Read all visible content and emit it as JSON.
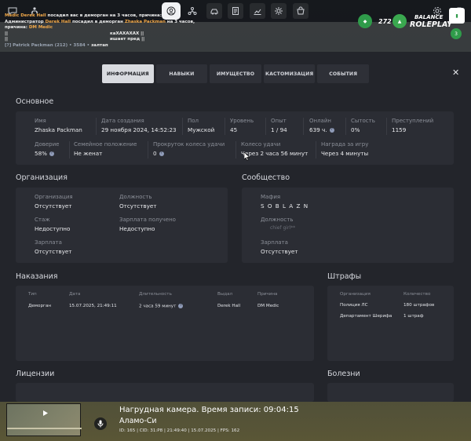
{
  "chat": {
    "line1_name": "Medic",
    "line1_prefix": "Derek Hall",
    "line1_text": "посадил вас в деморган на 3 часов, причина:",
    "line2_role": "Администратор",
    "line2_name": "Derek Hall",
    "line2_text": "посадил в деморган",
    "line2_target": "Zhaska Packman",
    "line2_tail": "на 3 часов,",
    "line3_text": "причина:",
    "line3_name": "DM Medic",
    "line4_text": "||",
    "line4_tail": "каXAXAXAX ||",
    "line5_text": "||",
    "line5_tail": "ишает пред ||",
    "line6_text": "[?] Patrick Packman (212) • 3584 •",
    "line6_tail": "залтап"
  },
  "hud": {
    "counter": "272",
    "logo_line1": "BALANCE",
    "logo_line2": "ROLEPLAY",
    "badge_small": "3"
  },
  "toolbar": {
    "icons": [
      "chat-icon",
      "character-icon",
      "profile-icon",
      "organization-icon",
      "car-icon",
      "document-icon",
      "stats-icon",
      "settings-gear-icon",
      "shop-icon"
    ]
  },
  "tabs": [
    "ИНФОРМАЦИЯ",
    "НАВЫКИ",
    "ИМУЩЕСТВО",
    "КАСТОМИЗАЦИЯ",
    "СОБЫТИЯ"
  ],
  "close_label": "✕",
  "basic": {
    "title": "Основное",
    "row1": [
      {
        "label": "Имя",
        "value": "Zhaska Packman"
      },
      {
        "label": "Дата создания",
        "value": "29 ноября 2024, 14:52:23"
      },
      {
        "label": "Пол",
        "value": "Мужской"
      },
      {
        "label": "Уровень",
        "value": "45"
      },
      {
        "label": "Опыт",
        "value": "1 / 94"
      },
      {
        "label": "Онлайн",
        "value": "639 ч."
      },
      {
        "label": "Сытость",
        "value": "0%"
      },
      {
        "label": "Преступлений",
        "value": "1159"
      }
    ],
    "row2": [
      {
        "label": "Доверие",
        "value": "58%"
      },
      {
        "label": "Семейное положение",
        "value": "Не женат"
      },
      {
        "label": "Прокруток колеса удачи",
        "value": "0"
      },
      {
        "label": "Колесо удачи",
        "value": "Через 2 часа 56 минут"
      },
      {
        "label": "Награда за игру",
        "value": "Через 4 минуты"
      }
    ]
  },
  "org": {
    "title": "Организация",
    "fields": [
      {
        "label": "Организация",
        "value": "Отсутствует"
      },
      {
        "label": "Должность",
        "value": "Отсутствует"
      },
      {
        "label": "Стаж",
        "value": "Недоступно"
      },
      {
        "label": "Зарплата получено",
        "value": "Недоступно"
      },
      {
        "label": "Зарплата",
        "value": "Отсутствует"
      }
    ]
  },
  "community": {
    "title": "Сообщество",
    "fields": [
      {
        "label": "Мафия",
        "value": "S O B L A Z N"
      },
      {
        "label": "Должность",
        "value": "chief girl**"
      },
      {
        "label": "Зарплата",
        "value": "Отсутствует"
      }
    ]
  },
  "punishments": {
    "title": "Наказания",
    "headers": [
      "Тип",
      "Дата",
      "Длительность",
      "Выдал",
      "Причина"
    ],
    "rows": [
      [
        "Деморган",
        "15.07.2025, 21:49:11",
        "2 часа 59 минут",
        "Derek Hall",
        "DM Medic"
      ]
    ]
  },
  "fines": {
    "title": "Штрафы",
    "headers": [
      "Организация",
      "Количество"
    ],
    "rows": [
      [
        "Полиция ЛС",
        "180 штрафов"
      ],
      [
        "Департамент Шерифа",
        "1 штраф"
      ]
    ]
  },
  "licenses": {
    "title": "Лицензии"
  },
  "diseases": {
    "title": "Болезни"
  },
  "bodycam": {
    "line1": "Нагрудная камера. Время записи: 09:04:15",
    "line2": "Аламо-Си",
    "line3": "ID: 165 | CID: 31:P8 | 21:49:40 | 15.07.2025 | FPS: 162"
  }
}
